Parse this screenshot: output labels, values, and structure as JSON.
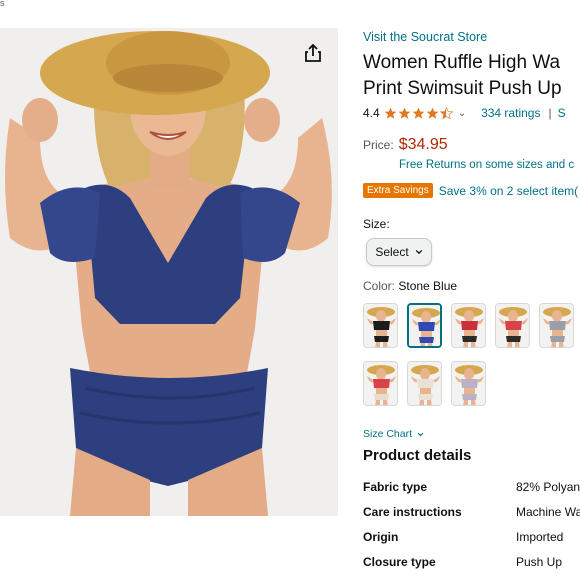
{
  "page": {
    "corner_fragment": "s"
  },
  "product_image": {
    "alt": "Woman in a straw hat wearing a navy blue ruffle high waisted bikini"
  },
  "share_icon": "share-icon",
  "store": {
    "link_text": "Visit the Soucrat Store"
  },
  "product": {
    "title": "Women Ruffle High Wa\nPrint Swimsuit Push Up"
  },
  "rating": {
    "value": "4.4",
    "stars": 4.4,
    "ratings_count_text": "334 ratings",
    "separator": "|",
    "trailing_fragment": "S"
  },
  "price": {
    "label": "Price:",
    "value": "$34.95",
    "returns_text": "Free Returns on some sizes and c"
  },
  "savings": {
    "badge": "Extra Savings",
    "text": "Save 3% on 2 select item("
  },
  "size": {
    "label": "Size:",
    "select_text": "Select"
  },
  "color": {
    "label": "Color:",
    "value": "Stone Blue",
    "swatches": [
      {
        "top": "#1c1c1c",
        "bottom": "#1c1c1c",
        "selected": false
      },
      {
        "top": "#2d4bb3",
        "bottom": "#2d4bb3",
        "selected": true
      },
      {
        "top": "#c8323a",
        "bottom": "#2b2b2b",
        "selected": false
      },
      {
        "top": "#d8434a",
        "bottom": "#2b2b2b",
        "selected": false
      },
      {
        "top": "#9a9fa8",
        "bottom": "#9a9fa8",
        "selected": false
      },
      {
        "top": "#d8434a",
        "bottom": "#e8dccc",
        "selected": false
      },
      {
        "top": "#e9e1d3",
        "bottom": "#e9e1d3",
        "selected": false
      },
      {
        "top": "#b9b2c4",
        "bottom": "#b9b2c4",
        "selected": false
      }
    ]
  },
  "size_chart": {
    "label": "Size Chart"
  },
  "product_details": {
    "heading": "Product details",
    "rows": [
      {
        "key": "Fabric type",
        "value": "82% Polyan"
      },
      {
        "key": "Care instructions",
        "value": "Machine Wa"
      },
      {
        "key": "Origin",
        "value": "Imported"
      },
      {
        "key": "Closure type",
        "value": "Push Up"
      }
    ]
  },
  "colors": {
    "link": "#007185",
    "price": "#b12704",
    "badge": "#e77600",
    "star": "#de7921",
    "text": "#0f1111",
    "swimsuit": "#2e3f7f"
  }
}
